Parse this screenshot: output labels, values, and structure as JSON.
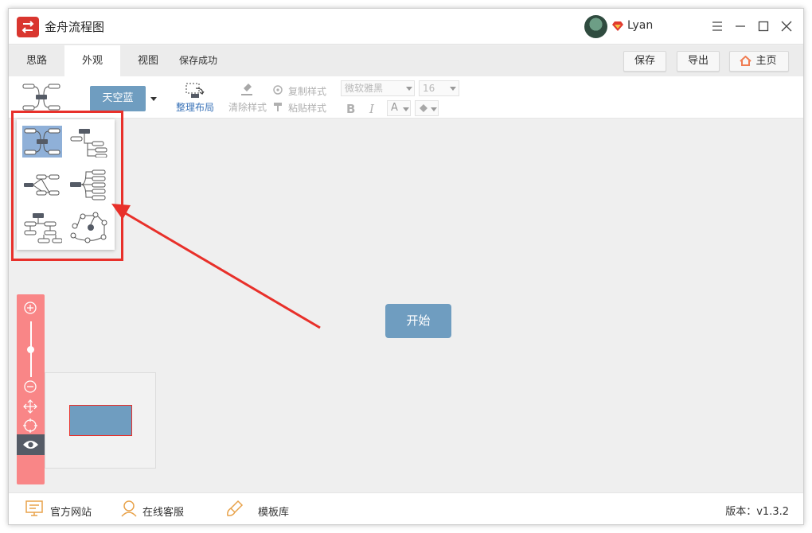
{
  "app": {
    "title": "金舟流程图",
    "username": "Lyan"
  },
  "tabs": [
    {
      "label": "思路",
      "active": false
    },
    {
      "label": "外观",
      "active": true
    },
    {
      "label": "视图",
      "active": false
    }
  ],
  "status": {
    "save": "保存成功"
  },
  "header_buttons": {
    "save": "保存",
    "export": "导出",
    "home": "主页"
  },
  "ribbon": {
    "theme": "天空蓝",
    "arrange_layout": "整理布局",
    "clear_style": "清除样式",
    "copy_style": "复制样式",
    "paste_style": "粘贴样式",
    "font_family": "微软雅黑",
    "font_size": "16",
    "bold": "B",
    "italic": "I",
    "font_color": "A"
  },
  "layout_popup": {
    "options": [
      {
        "icon": "mindmap-both-sides-icon",
        "selected": true
      },
      {
        "icon": "org-chart-right-icon",
        "selected": false
      },
      {
        "icon": "logic-chart-icon",
        "selected": false
      },
      {
        "icon": "bracket-tree-icon",
        "selected": false
      },
      {
        "icon": "tree-down-icon",
        "selected": false
      },
      {
        "icon": "free-network-icon",
        "selected": false
      }
    ]
  },
  "canvas": {
    "start_node": "开始"
  },
  "footer": {
    "official_site": "官方网站",
    "online_service": "在线客服",
    "template_library": "模板库",
    "version": "版本：v1.3.2"
  },
  "colors": {
    "accent": "#6f9dc0",
    "highlight": "#e8302a",
    "zoom_panel": "#f98687",
    "brand": "#d9362f"
  }
}
